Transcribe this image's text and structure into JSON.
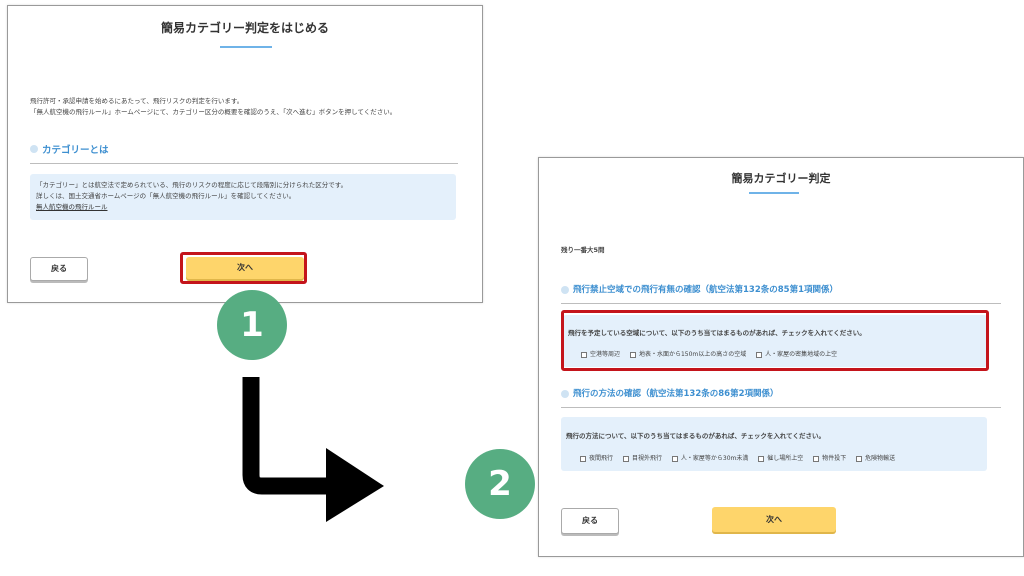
{
  "step1": {
    "title": "簡易カテゴリー判定をはじめる",
    "intro_line1": "飛行許可・承認申請を始めるにあたって、飛行リスクの判定を行います。",
    "intro_line2": "「無人航空機の飛行ルール」ホームページにて、カテゴリー区分の概要を確認のうえ、「次へ進む」ボタンを押してください。",
    "section_title": "カテゴリーとは",
    "info_line1": "「カテゴリー」とは航空法で定められている、飛行のリスクの程度に応じて段階別に分けられた区分です。",
    "info_line2": "詳しくは、国土交通省ホームページの「無人航空機の飛行ルール」を確認してください。",
    "info_link": "無人航空機の飛行ルール",
    "back_label": "戻る",
    "next_label": "次へ"
  },
  "step2": {
    "title": "簡易カテゴリー判定",
    "remaining": "残り一番大5問",
    "section1_title": "飛行禁止空域での飛行有無の確認（航空法第132条の85第1項関係）",
    "section1_question": "飛行を予定している空域について、以下のうち当てはまるものがあれば、チェックを入れてください。",
    "section1_options": [
      "空港等周辺",
      "地表・水面から150m以上の高さの空域",
      "人・家屋の密集地域の上空"
    ],
    "section2_title": "飛行の方法の確認（航空法第132条の86第2項関係）",
    "section2_question": "飛行の方法について、以下のうち当てはまるものがあれば、チェックを入れてください。",
    "section2_options": [
      "夜間飛行",
      "目視外飛行",
      "人・家屋等から30m未満",
      "催し場所上空",
      "物件投下",
      "危険物輸送"
    ],
    "back_label": "戻る",
    "next_label": "次へ"
  },
  "badges": {
    "first": "1",
    "second": "2"
  },
  "colors": {
    "accent": "#3d8fd0",
    "next_button": "#fed56b",
    "highlight_frame": "#c4141b",
    "badge": "#57ad82",
    "info_bg": "#e4f0fb"
  }
}
